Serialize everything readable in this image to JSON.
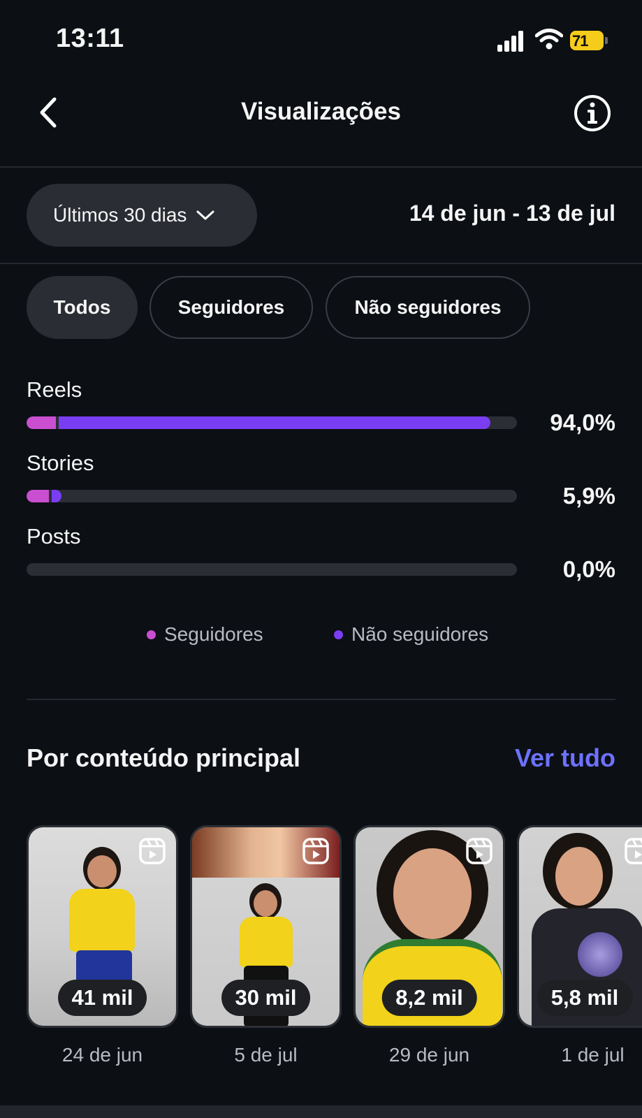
{
  "status": {
    "time": "13:11",
    "battery": "71"
  },
  "header": {
    "title": "Visualizações",
    "back_icon": "chevron-left-icon",
    "info_icon": "info-icon"
  },
  "period": {
    "label": "Últimos 30 dias",
    "range": "14 de jun - 13 de jul"
  },
  "filters": [
    {
      "label": "Todos",
      "active": true
    },
    {
      "label": "Seguidores",
      "active": false
    },
    {
      "label": "Não seguidores",
      "active": false
    }
  ],
  "breakdown": [
    {
      "label": "Reels",
      "percent": "94,0%",
      "followers_fraction": 0.06,
      "nonfollowers_fraction": 0.88
    },
    {
      "label": "Stories",
      "percent": "5,9%",
      "followers_fraction": 0.045,
      "nonfollowers_fraction": 0.02
    },
    {
      "label": "Posts",
      "percent": "0,0%",
      "followers_fraction": 0,
      "nonfollowers_fraction": 0
    }
  ],
  "legend": {
    "followers": "Seguidores",
    "nonfollowers": "Não seguidores"
  },
  "colors": {
    "followers": "#c94fd0",
    "nonfollowers": "#7a3ef2",
    "link": "#6d72ff",
    "background": "#0c0f14"
  },
  "content": {
    "title": "Por conteúdo principal",
    "see_all": "Ver tudo",
    "items": [
      {
        "views": "41 mil",
        "date": "24 de jun",
        "icon": "reel-icon"
      },
      {
        "views": "30 mil",
        "date": "5 de jul",
        "icon": "reel-icon"
      },
      {
        "views": "8,2 mil",
        "date": "29 de jun",
        "icon": "reel-icon"
      },
      {
        "views": "5,8 mil",
        "date": "1 de jul",
        "icon": "reel-icon"
      }
    ]
  }
}
